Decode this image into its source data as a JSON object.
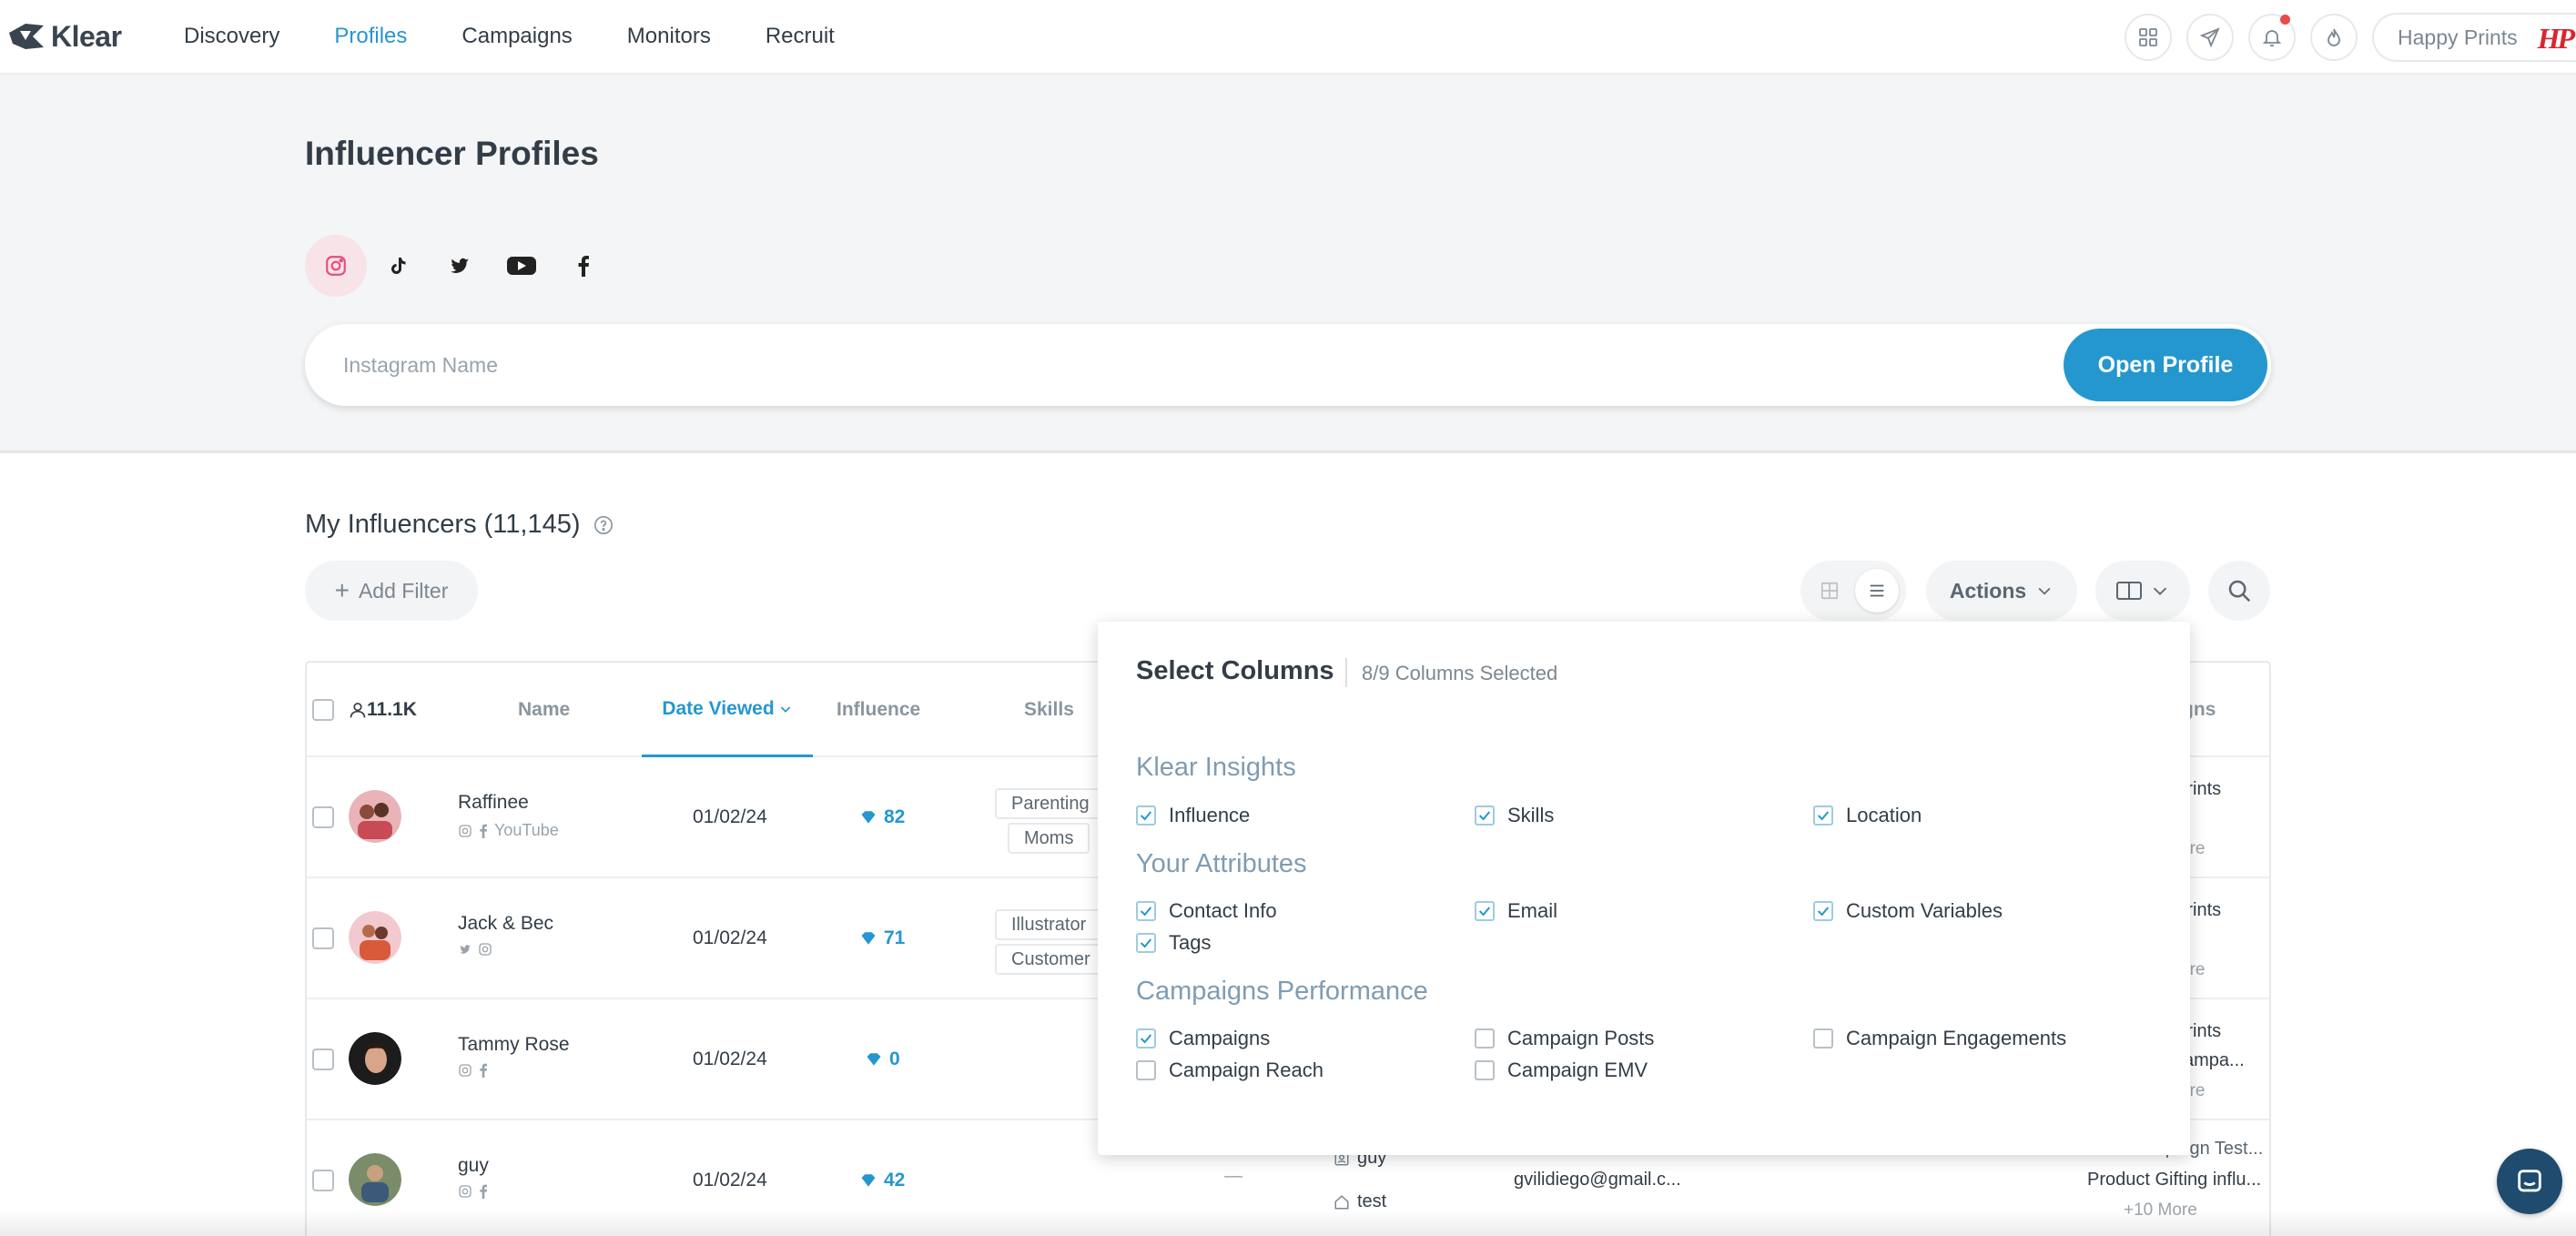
{
  "nav": {
    "brand": "Klear",
    "links": [
      {
        "label": "Discovery",
        "active": false
      },
      {
        "label": "Profiles",
        "active": true
      },
      {
        "label": "Campaigns",
        "active": false
      },
      {
        "label": "Monitors",
        "active": false
      },
      {
        "label": "Recruit",
        "active": false
      }
    ],
    "icons": [
      "apps-grid-icon",
      "send-icon",
      "bell-icon",
      "flame-icon"
    ],
    "account": "Happy Prints",
    "account_logo": "HP",
    "accent": "#2597cf"
  },
  "hero": {
    "title": "Influencer Profiles",
    "platforms": [
      "instagram-icon",
      "tiktok-icon",
      "twitter-icon",
      "youtube-icon",
      "facebook-icon"
    ],
    "search_placeholder": "Instagram Name",
    "open_button": "Open Profile"
  },
  "list": {
    "title": "My Influencers (11,145)",
    "add_filter": "Add Filter",
    "actions": "Actions"
  },
  "table": {
    "headers": {
      "count": "11.1K",
      "name": "Name",
      "date": "Date Viewed",
      "influence": "Influence",
      "skills": "Skills",
      "campaigns": "gns"
    },
    "rows": [
      {
        "name": "Raffinee",
        "sub": "YouTube",
        "date": "01/02/24",
        "influence": "82",
        "tags": [
          "Parenting",
          "Moms"
        ],
        "campaigns": [
          "Prints",
          "t"
        ],
        "more": "ore"
      },
      {
        "name": "Jack & Bec",
        "sub": "",
        "date": "01/02/24",
        "influence": "71",
        "tags": [
          "Illustrator",
          "Customer"
        ],
        "campaigns": [
          "Prints",
          "t"
        ],
        "more": "ore"
      },
      {
        "name": "Tammy Rose",
        "sub": "",
        "date": "01/02/24",
        "influence": "0",
        "tags": [],
        "campaigns": [
          "Prints",
          "campa..."
        ],
        "more": "ore"
      },
      {
        "name": "guy",
        "sub": "",
        "date": "01/02/24",
        "influence": "42",
        "dash": "—",
        "contact_name": "guy",
        "contact_tag": "test",
        "email": "gvilidiego@gmail.c...",
        "campaigns": [
          "New Campaign Test...",
          "Product Gifting influ..."
        ],
        "more": "+10 More"
      }
    ]
  },
  "popover": {
    "title": "Select Columns",
    "count": "8/9 Columns Selected",
    "sections": [
      {
        "title": "Klear Insights",
        "items": [
          {
            "label": "Influence",
            "checked": true
          },
          {
            "label": "Skills",
            "checked": true
          },
          {
            "label": "Location",
            "checked": true
          }
        ]
      },
      {
        "title": "Your Attributes",
        "items": [
          {
            "label": "Contact Info",
            "checked": true
          },
          {
            "label": "Email",
            "checked": true
          },
          {
            "label": "Custom Variables",
            "checked": true
          },
          {
            "label": "Tags",
            "checked": true
          }
        ]
      },
      {
        "title": "Campaigns Performance",
        "items": [
          {
            "label": "Campaigns",
            "checked": true
          },
          {
            "label": "Campaign Posts",
            "checked": false
          },
          {
            "label": "Campaign Engagements",
            "checked": false
          },
          {
            "label": "Campaign Reach",
            "checked": false
          },
          {
            "label": "Campaign EMV",
            "checked": false
          }
        ]
      }
    ]
  }
}
